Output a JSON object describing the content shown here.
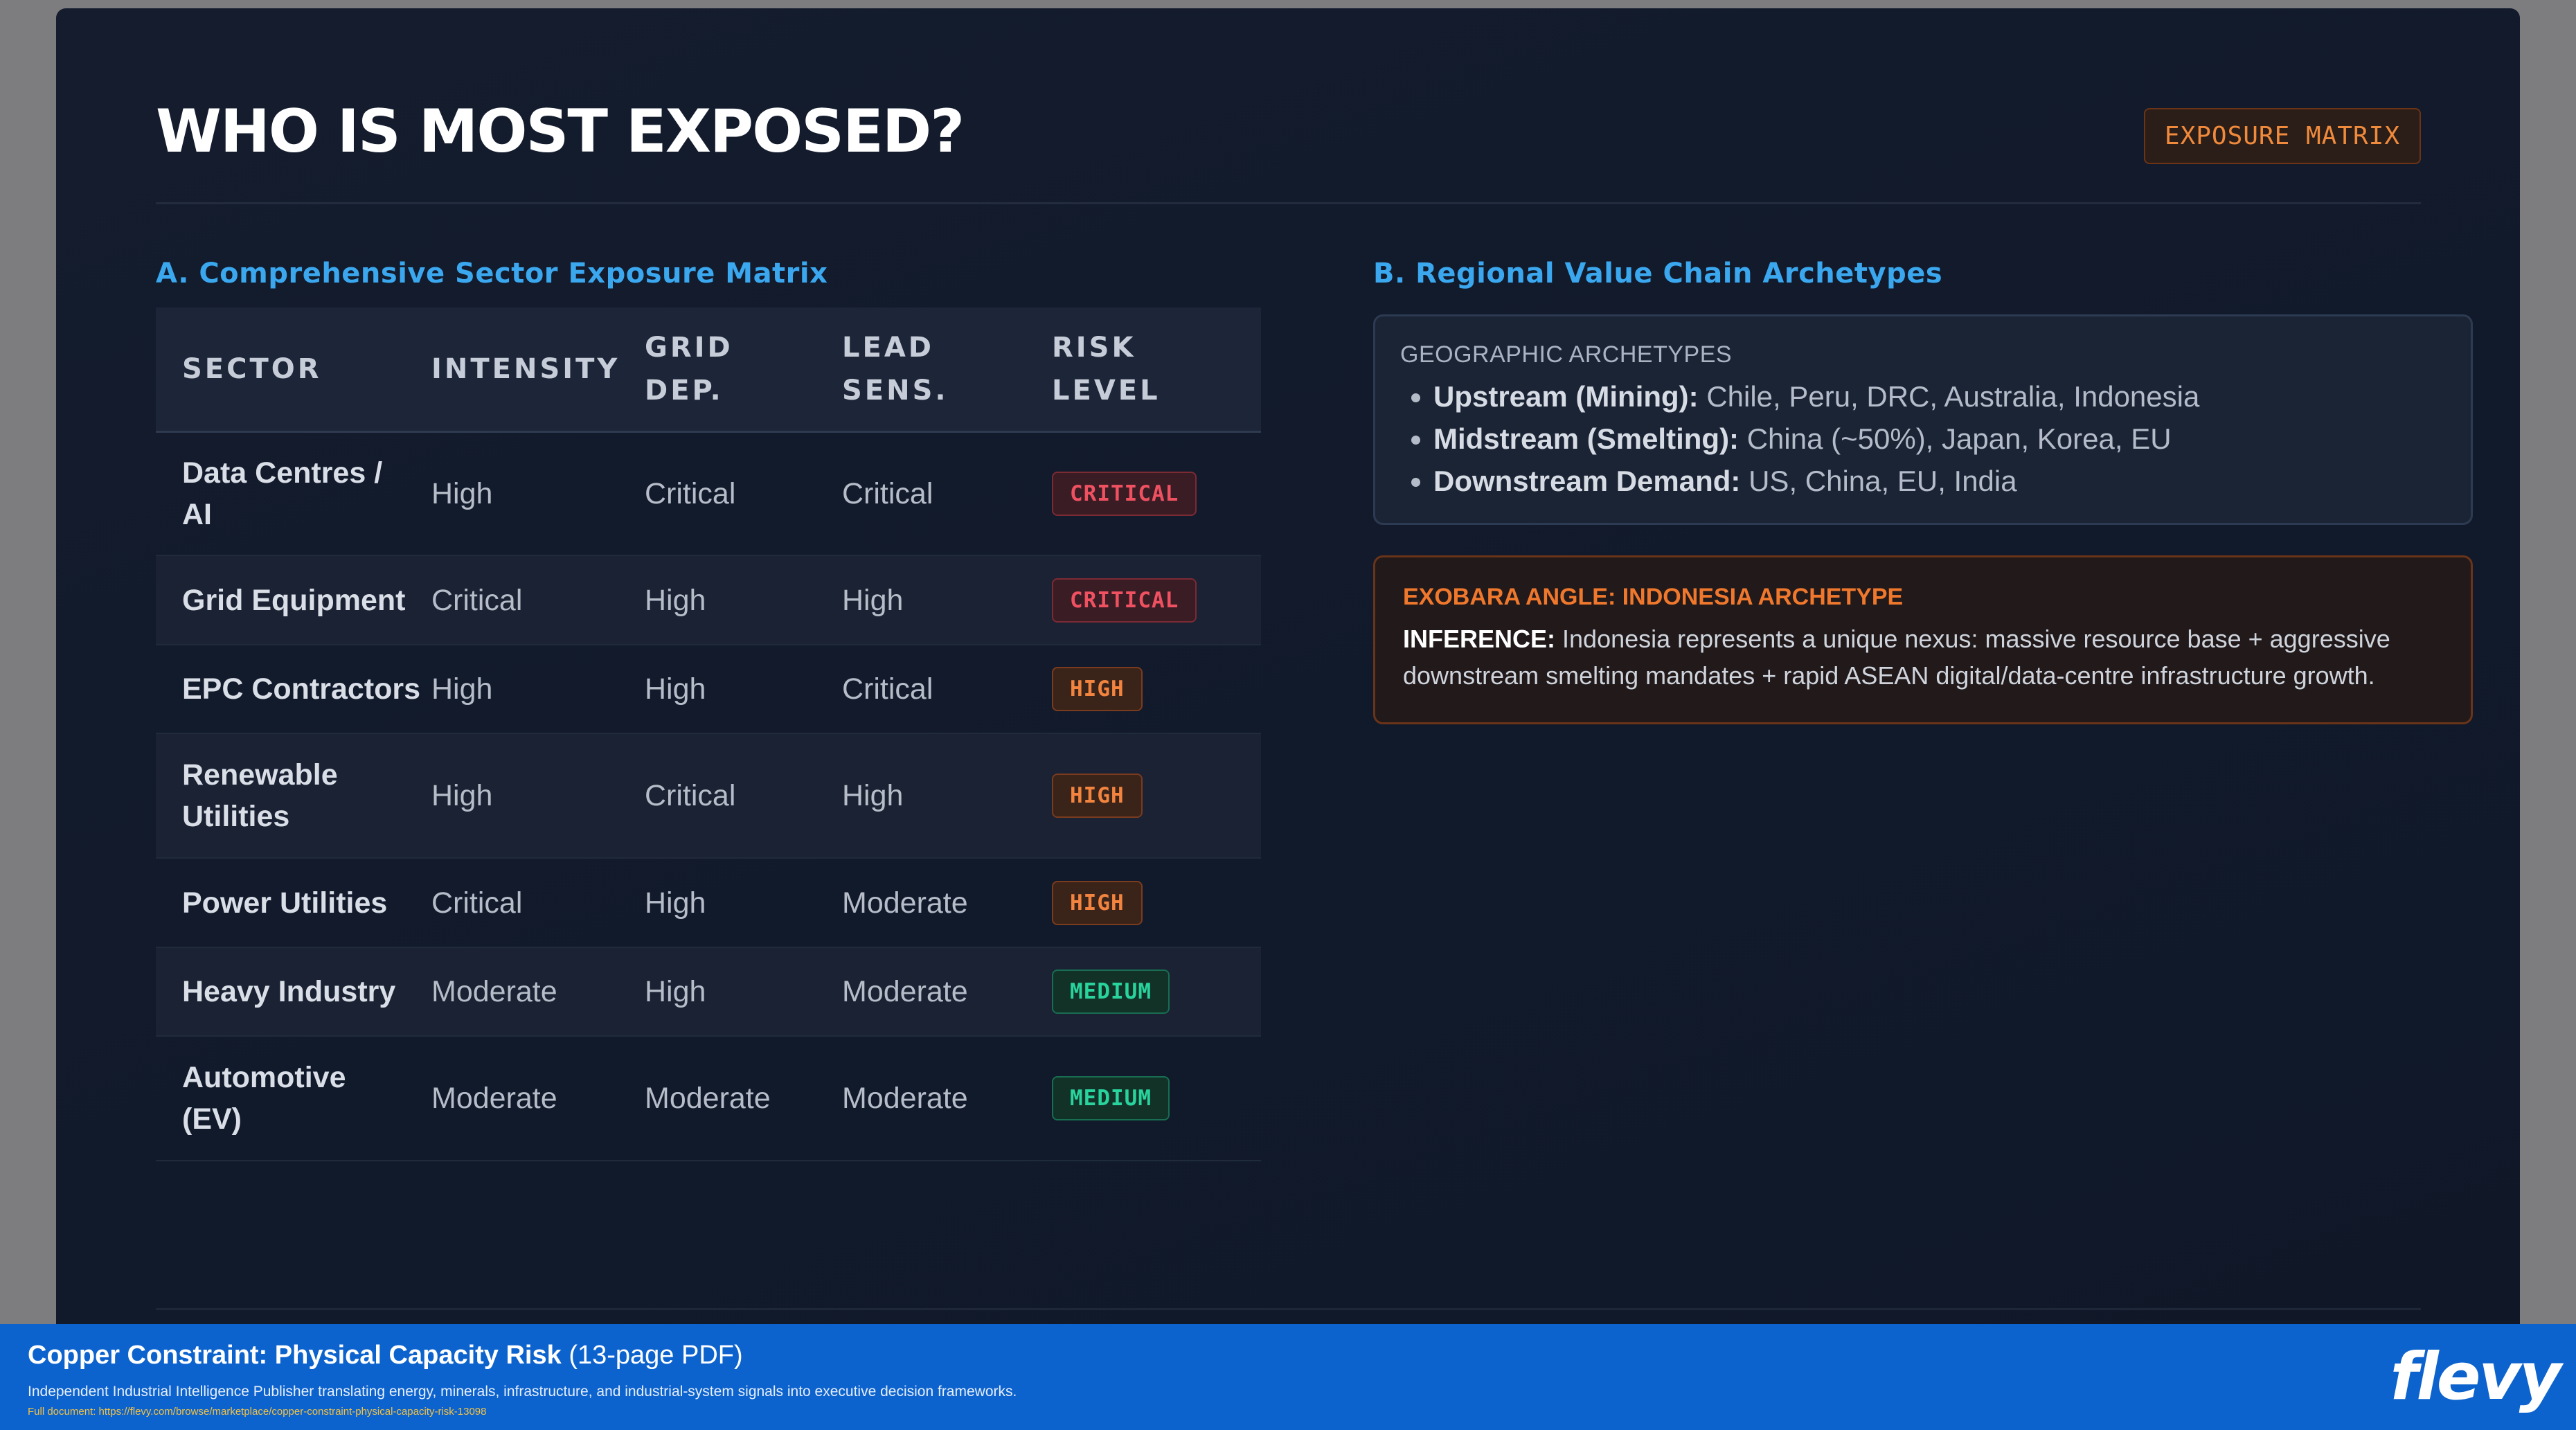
{
  "slide": {
    "title": "WHO IS MOST EXPOSED?",
    "tag": "EXPOSURE MATRIX"
  },
  "section_a": {
    "title": "A. Comprehensive Sector Exposure Matrix",
    "headers": [
      {
        "l1": "SECTOR",
        "l2": ""
      },
      {
        "l1": "INTENSITY",
        "l2": ""
      },
      {
        "l1": "GRID",
        "l2": "DEP."
      },
      {
        "l1": "LEAD",
        "l2": "SENS."
      },
      {
        "l1": "RISK",
        "l2": "LEVEL"
      }
    ],
    "rows": [
      {
        "s1": "Data Centres /",
        "s2": "AI",
        "intensity": "High",
        "grid": "Critical",
        "lead": "Critical",
        "risk": "CRITICAL"
      },
      {
        "s1": "Grid Equipment",
        "s2": "",
        "intensity": "Critical",
        "grid": "High",
        "lead": "High",
        "risk": "CRITICAL"
      },
      {
        "s1": "EPC Contractors",
        "s2": "",
        "intensity": "High",
        "grid": "High",
        "lead": "Critical",
        "risk": "HIGH"
      },
      {
        "s1": "Renewable",
        "s2": "Utilities",
        "intensity": "High",
        "grid": "Critical",
        "lead": "High",
        "risk": "HIGH"
      },
      {
        "s1": "Power Utilities",
        "s2": "",
        "intensity": "Critical",
        "grid": "High",
        "lead": "Moderate",
        "risk": "HIGH"
      },
      {
        "s1": "Heavy Industry",
        "s2": "",
        "intensity": "Moderate",
        "grid": "High",
        "lead": "Moderate",
        "risk": "MEDIUM"
      },
      {
        "s1": "Automotive",
        "s2": "(EV)",
        "intensity": "Moderate",
        "grid": "Moderate",
        "lead": "Moderate",
        "risk": "MEDIUM"
      }
    ],
    "risk_colors": {
      "CRITICAL": "#ef5161",
      "HIGH": "#f2843f",
      "MEDIUM": "#28d39c"
    }
  },
  "section_b": {
    "title": "B. Regional Value Chain Archetypes",
    "geo_title": "GEOGRAPHIC ARCHETYPES",
    "items": [
      {
        "label": "Upstream (Mining):",
        "text": "Chile, Peru, DRC, Australia, Indonesia"
      },
      {
        "label": "Midstream (Smelting):",
        "text": "China (~50%), Japan, Korea, EU"
      },
      {
        "label": "Downstream Demand:",
        "text": "US, China, EU, India"
      }
    ],
    "angle_title": "EXOBARA ANGLE: INDONESIA ARCHETYPE",
    "angle_label": "INFERENCE:",
    "angle_text": "Indonesia represents a unique nexus: massive resource base + aggressive downstream smelting mandates + rapid ASEAN digital/data-centre infrastructure growth."
  },
  "footer": {
    "title": "Copper Constraint: Physical Capacity Risk",
    "pages": "(13-page PDF)",
    "description": "Independent Industrial Intelligence Publisher translating energy, minerals, infrastructure, and industrial-system signals into executive decision frameworks.",
    "link": "Full document: https://flevy.com/browse/marketplace/copper-constraint-physical-capacity-risk-13098",
    "logo": "flevy"
  },
  "colors": {
    "background": "#111a2b",
    "accent_blue": "#3aa7ee",
    "accent_orange": "#f0782d",
    "footer_blue": "#0d63cd"
  }
}
